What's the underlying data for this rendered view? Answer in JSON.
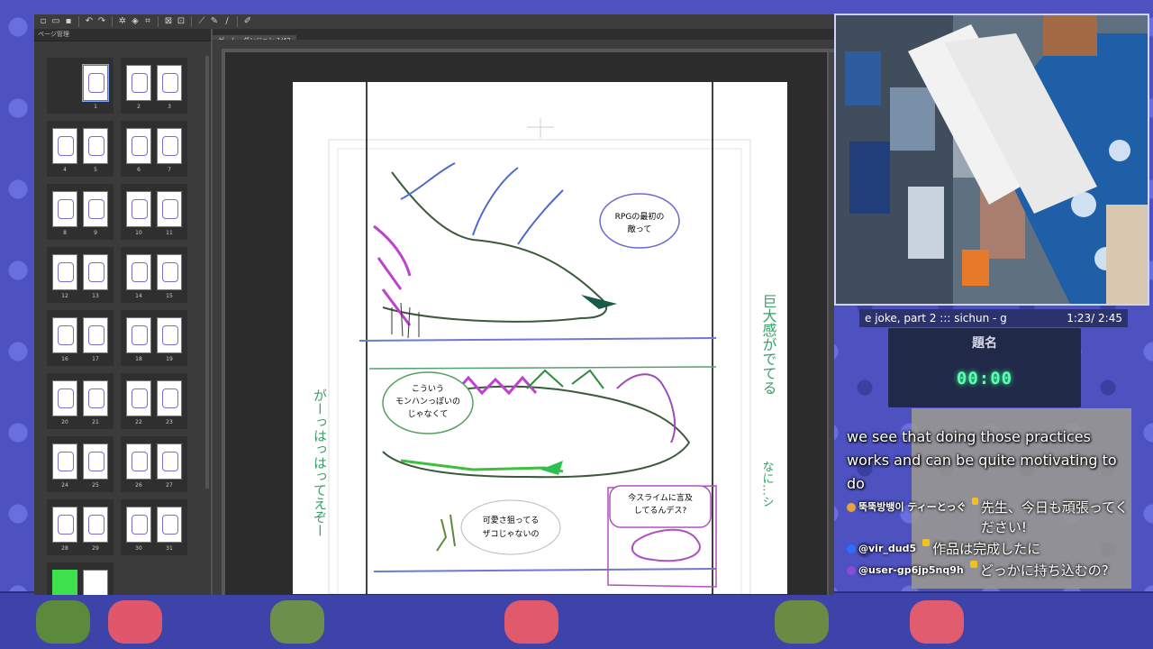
{
  "app": {
    "panel_title": "ページ管理",
    "document_tab": "ゲーム・ダンジョン 1/42",
    "pages": [
      "1",
      "2",
      "3",
      "4",
      "5",
      "6",
      "7",
      "8",
      "9",
      "10",
      "11",
      "12",
      "13",
      "14",
      "15",
      "16",
      "17",
      "18",
      "19",
      "20",
      "21",
      "22",
      "23",
      "24",
      "25",
      "26",
      "27",
      "28",
      "29",
      "30",
      "31"
    ]
  },
  "canvas": {
    "bubbles": {
      "b1": [
        "RPGの最初の",
        "敵って"
      ],
      "b2": [
        "こういう",
        "モンハンっぽいの",
        "じゃなくて"
      ],
      "b3": [
        "可愛さ狙ってる",
        "ザコじゃないの"
      ],
      "b4": [
        "今スライムに言及",
        "してるんデス?"
      ]
    },
    "margin_notes": {
      "right_top": "巨大感がでてる",
      "right_bottom": "なに…シ",
      "left": "がーっはっはってえぞー"
    }
  },
  "stream": {
    "now_playing": "e joke, part 2  :::  sichun - g",
    "track_time": "1:23/ 2:45",
    "timer_title": "題名",
    "timer_value": "00:00",
    "caption": "we see that doing those practices works and can be quite motivating to do",
    "chat": [
      {
        "user": "뚝뚝방뱅이  ティーとっぐ",
        "text": "先生、今日も頑張ってください!",
        "avatar_color": "#e8a33b"
      },
      {
        "user": "@vir_dud5",
        "text": "作品は完成したに",
        "avatar_color": "#2b6fff"
      },
      {
        "user": "@user-gp6jp5nq9h",
        "text": "どっかに持ち込むの?",
        "avatar_color": "#8a4bd6"
      }
    ]
  }
}
